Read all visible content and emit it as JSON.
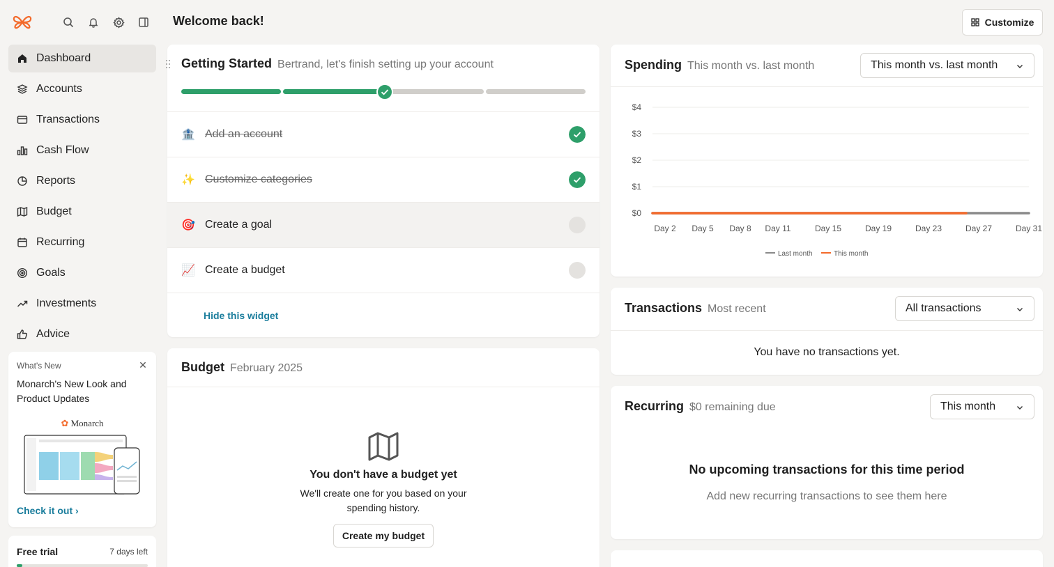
{
  "header": {
    "welcome": "Welcome back!",
    "customize_label": "Customize"
  },
  "sidebar": {
    "items": [
      {
        "label": "Dashboard",
        "icon": "home-icon",
        "active": true
      },
      {
        "label": "Accounts",
        "icon": "layers-icon"
      },
      {
        "label": "Transactions",
        "icon": "credit-card-icon"
      },
      {
        "label": "Cash Flow",
        "icon": "bar-chart-icon"
      },
      {
        "label": "Reports",
        "icon": "pie-chart-icon"
      },
      {
        "label": "Budget",
        "icon": "map-icon"
      },
      {
        "label": "Recurring",
        "icon": "calendar-icon"
      },
      {
        "label": "Goals",
        "icon": "target-icon"
      },
      {
        "label": "Investments",
        "icon": "trending-up-icon"
      },
      {
        "label": "Advice",
        "icon": "thumbs-up-icon"
      }
    ],
    "whats_new": {
      "label": "What's New",
      "title": "Monarch's New Look and Product Updates",
      "brand": "Monarch",
      "link": "Check it out"
    },
    "trial": {
      "label": "Free trial",
      "days_left": "7 days left"
    }
  },
  "getting_started": {
    "title": "Getting Started",
    "subtitle": "Bertrand, let's finish setting up your account",
    "progress_steps_completed": 2,
    "progress_steps_total": 4,
    "steps": [
      {
        "label": "Add an account",
        "emoji": "🏦",
        "done": true
      },
      {
        "label": "Customize categories",
        "emoji": "✨",
        "done": true
      },
      {
        "label": "Create a goal",
        "emoji": "🎯",
        "done": false
      },
      {
        "label": "Create a budget",
        "emoji": "📈",
        "done": false
      }
    ],
    "hide_label": "Hide this widget"
  },
  "budget": {
    "title": "Budget",
    "subtitle": "February 2025",
    "empty_title": "You don't have a budget yet",
    "empty_desc": "We'll create one for you based on your spending history.",
    "button": "Create my budget"
  },
  "spending": {
    "title": "Spending",
    "subtitle": "This month vs. last month",
    "select": "This month vs. last month"
  },
  "chart_data": {
    "type": "line",
    "x_ticks": [
      "Day 2",
      "Day 5",
      "Day 8",
      "Day 11",
      "Day 15",
      "Day 19",
      "Day 23",
      "Day 27",
      "Day 31"
    ],
    "y_ticks": [
      "$0",
      "$1",
      "$2",
      "$3",
      "$4"
    ],
    "ylim": [
      0,
      4
    ],
    "xlim": [
      1,
      31
    ],
    "series": [
      {
        "name": "Last month",
        "color": "#8a8a8a",
        "x": [
          1,
          31
        ],
        "y": [
          0,
          0
        ]
      },
      {
        "name": "This month",
        "color": "#f36a2b",
        "x": [
          1,
          26
        ],
        "y": [
          0,
          0
        ]
      }
    ],
    "grid": true,
    "legend": "bottom-center"
  },
  "transactions": {
    "title": "Transactions",
    "subtitle": "Most recent",
    "select": "All transactions",
    "empty": "You have no transactions yet."
  },
  "recurring": {
    "title": "Recurring",
    "subtitle": "$0 remaining due",
    "select": "This month",
    "empty_title": "No upcoming transactions for this time period",
    "empty_desc": "Add new recurring transactions to see them here"
  },
  "colors": {
    "accent": "#1a7d9c",
    "success": "#2e9f6a",
    "brand": "#f36a2b"
  }
}
